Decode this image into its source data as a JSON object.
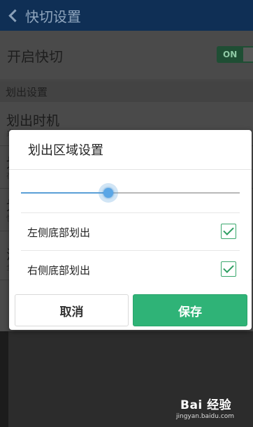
{
  "header": {
    "title": "快切设置"
  },
  "main": {
    "enable_label": "开启快切",
    "toggle_label": "ON",
    "section_title": "划出设置",
    "items": [
      {
        "title": "划出时机",
        "subtitle": "桌"
      },
      {
        "title": "划",
        "subtitle": "在"
      },
      {
        "title": "划",
        "subtitle": "快"
      },
      {
        "title": "滑",
        "subtitle": "全"
      }
    ]
  },
  "dialog": {
    "title": "划出区域设置",
    "slider_value_fraction": 0.4,
    "options": [
      {
        "label": "左侧底部划出",
        "checked": true
      },
      {
        "label": "右侧底部划出",
        "checked": true
      }
    ],
    "cancel_label": "取消",
    "save_label": "保存"
  },
  "watermark": {
    "brand": "Bai 经验",
    "url": "jingyan.baidu.com"
  },
  "colors": {
    "accent_green": "#2fb377",
    "slider_blue": "#5aa6e6",
    "titlebar": "#0f2f55"
  }
}
